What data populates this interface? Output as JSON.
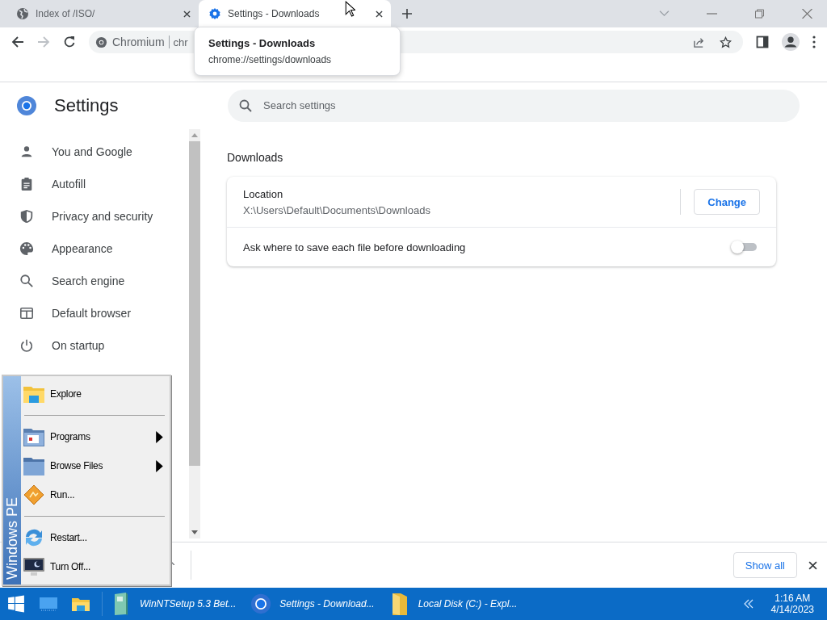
{
  "browser_tabs": [
    {
      "title": "Index of /ISO/",
      "kind": "web",
      "selected": false
    },
    {
      "title": "Settings - Downloads",
      "kind": "settings",
      "selected": true
    }
  ],
  "tab_tooltip": {
    "title": "Settings - Downloads",
    "url": "chrome://settings/downloads"
  },
  "address_bar": {
    "site": "Chromium",
    "url": "chr"
  },
  "settings": {
    "title": "Settings",
    "search": {
      "placeholder": "Search settings"
    },
    "menu": [
      {
        "label": "You and Google",
        "kind": "person"
      },
      {
        "label": "Autofill",
        "kind": "clipboard"
      },
      {
        "label": "Privacy and security",
        "kind": "shield"
      },
      {
        "label": "Appearance",
        "kind": "palette"
      },
      {
        "label": "Search engine",
        "kind": "search"
      },
      {
        "label": "Default browser",
        "kind": "browser"
      },
      {
        "label": "On startup",
        "kind": "power"
      }
    ],
    "section_heading": "Downloads",
    "location": {
      "label": "Location",
      "path": "X:\\Users\\Default\\Documents\\Downloads",
      "button": "Change"
    },
    "ask_before_download": {
      "label": "Ask where to save each file before downloading",
      "on": false
    }
  },
  "download_bar": {
    "button": "Show all"
  },
  "start_menu": {
    "banner": "Windows PE",
    "groups": [
      [
        {
          "label": "Explore",
          "kind": "explore",
          "submenu": false
        }
      ],
      [
        {
          "label": "Programs",
          "kind": "programs",
          "submenu": true
        },
        {
          "label": "Browse Files",
          "kind": "folder",
          "submenu": true
        },
        {
          "label": "Run...",
          "kind": "run",
          "submenu": false
        }
      ],
      [
        {
          "label": "Restart...",
          "kind": "restart",
          "submenu": false
        },
        {
          "label": "Turn Off...",
          "kind": "turnoff",
          "submenu": false
        }
      ]
    ]
  },
  "taskbar": {
    "tasks": [
      {
        "label": "WinNTSetup 5.3 Bet...",
        "kind": "setup"
      },
      {
        "label": "Settings - Download...",
        "kind": "browser"
      },
      {
        "label": "Local Disk (C:) - Expl...",
        "kind": "explorer"
      }
    ],
    "clock": {
      "time": "1:16 AM",
      "date": "4/14/2023"
    }
  }
}
